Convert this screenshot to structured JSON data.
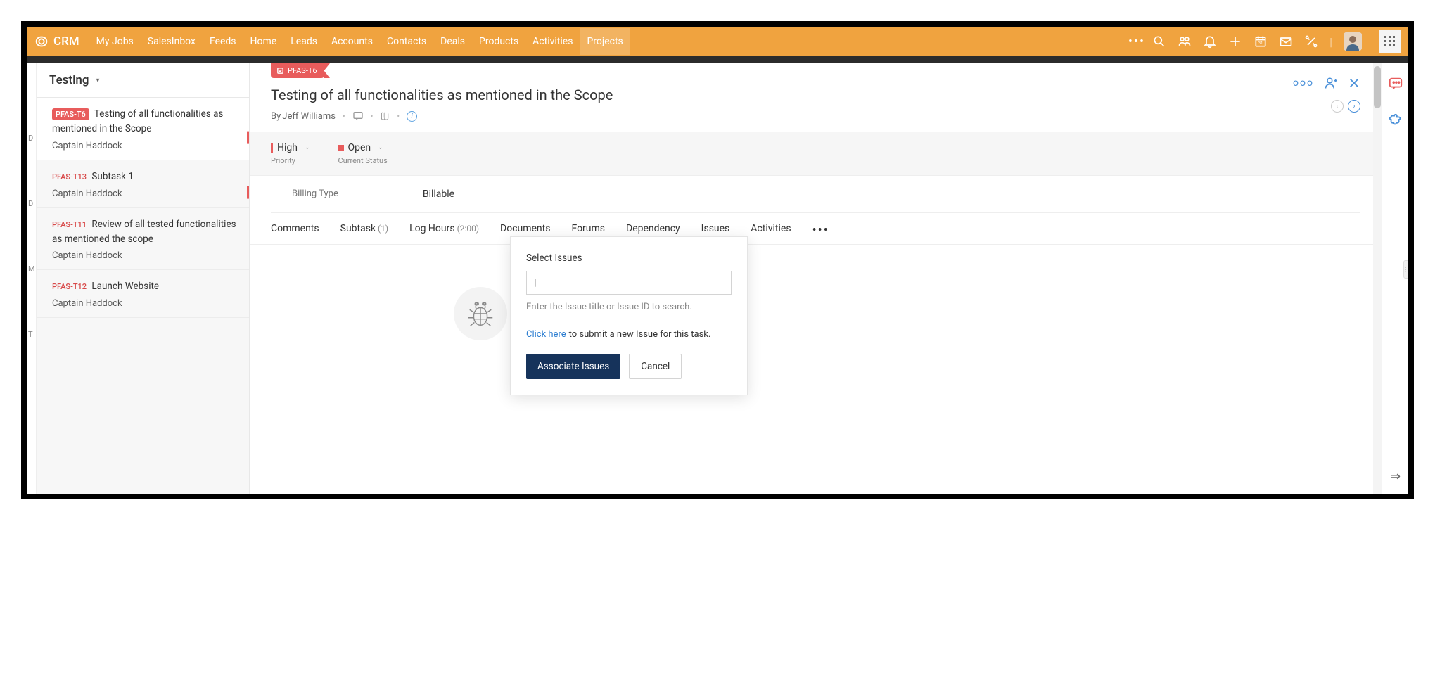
{
  "brand": "CRM",
  "nav": [
    "My Jobs",
    "SalesInbox",
    "Feeds",
    "Home",
    "Leads",
    "Accounts",
    "Contacts",
    "Deals",
    "Products",
    "Activities",
    "Projects"
  ],
  "nav_active": "Projects",
  "sidebar": {
    "header": "Testing",
    "tasks": [
      {
        "id": "PFAS-T6",
        "badge": true,
        "title": "Testing of all functionalities as mentioned in the Scope",
        "owner": "Captain Haddock",
        "selected": true
      },
      {
        "id": "PFAS-T13",
        "title": "Subtask 1",
        "owner": "Captain Haddock",
        "redmark": true
      },
      {
        "id": "PFAS-T11",
        "title": "Review of all tested functionalities as mentioned the scope",
        "owner": "Captain Haddock"
      },
      {
        "id": "PFAS-T12",
        "title": "Launch Website",
        "owner": "Captain Haddock"
      }
    ]
  },
  "detail": {
    "badge_id": "PFAS-T6",
    "title": "Testing of all functionalities as mentioned in the Scope",
    "author_prefix": "By ",
    "author": "Jeff Williams",
    "priority": {
      "value": "High",
      "label": "Priority"
    },
    "status": {
      "value": "Open",
      "label": "Current Status"
    },
    "billing": {
      "label": "Billing Type",
      "value": "Billable"
    },
    "tabs": [
      {
        "label": "Comments"
      },
      {
        "label": "Subtask",
        "count": "(1)"
      },
      {
        "label": "Log Hours",
        "count": "(2:00)"
      },
      {
        "label": "Documents"
      },
      {
        "label": "Forums"
      },
      {
        "label": "Dependency"
      },
      {
        "label": "Issues",
        "active": true
      },
      {
        "label": "Activities"
      }
    ]
  },
  "popover": {
    "label": "Select Issues",
    "hint": "Enter the Issue title or Issue ID to search.",
    "link": "Click here",
    "link_suffix": "  to submit a new Issue for this task.",
    "primary": "Associate Issues",
    "cancel": "Cancel"
  },
  "gutter_labels": [
    "D",
    "D",
    "M",
    "T"
  ]
}
